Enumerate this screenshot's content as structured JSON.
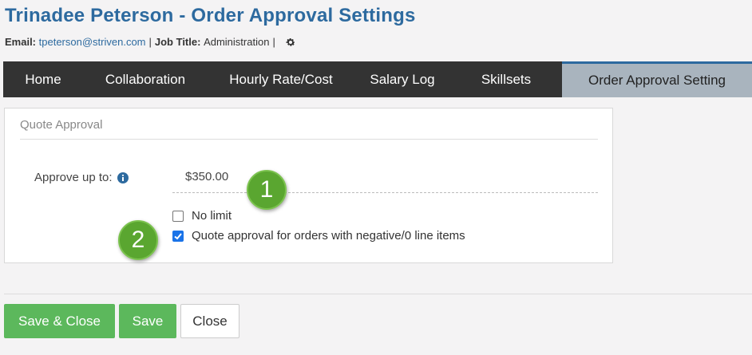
{
  "header": {
    "title": "Trinadee Peterson - Order Approval Settings",
    "email_label": "Email:",
    "email_value": "tpeterson@striven.com",
    "job_title_label": "Job Title:",
    "job_title_value": "Administration",
    "separator": "|",
    "settings_icon": "gear-icon"
  },
  "tabs": [
    {
      "label": "Home"
    },
    {
      "label": "Collaboration"
    },
    {
      "label": "Hourly Rate/Cost"
    },
    {
      "label": "Salary Log"
    },
    {
      "label": "Skillsets"
    },
    {
      "label": "Order Approval Setting",
      "active": true
    }
  ],
  "quote_approval": {
    "section_title": "Quote Approval",
    "approve_label": "Approve up to:",
    "info_icon": "info-icon",
    "amount": "$350.00",
    "no_limit_label": "No limit",
    "no_limit_checked": false,
    "negative_label": "Quote approval for orders with negative/0 line items",
    "negative_checked": true
  },
  "callouts": [
    "1",
    "2"
  ],
  "buttons": {
    "save_close": "Save & Close",
    "save": "Save",
    "close": "Close"
  },
  "colors": {
    "title": "#2d6a9f",
    "tab_bar": "#333333",
    "active_tab": "#a9b4be",
    "callout": "#5aa630",
    "save_button": "#5cb85c",
    "checkbox": "#1a73e8"
  }
}
